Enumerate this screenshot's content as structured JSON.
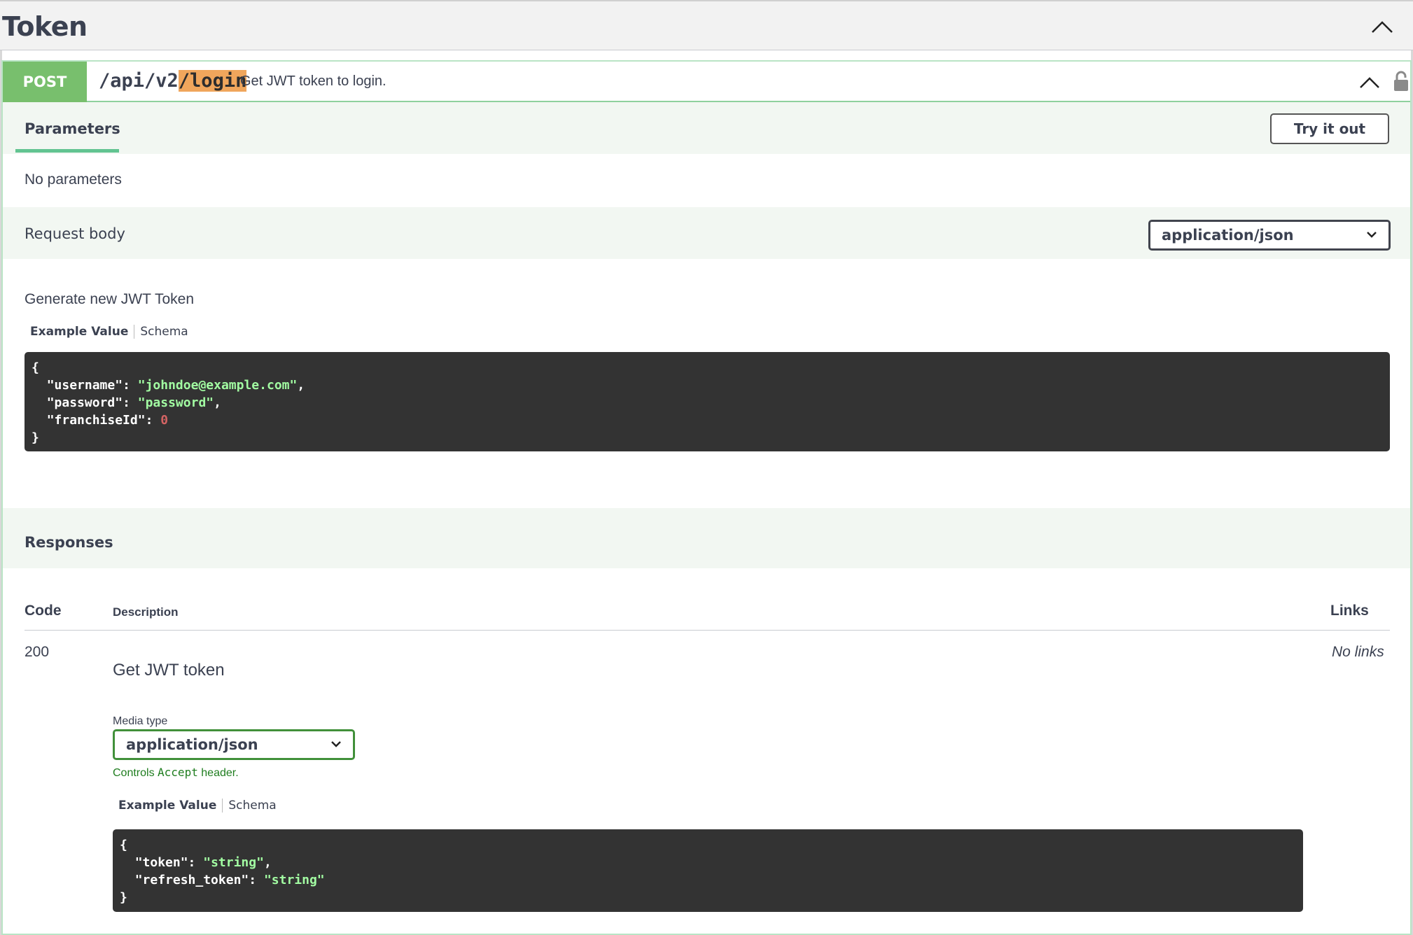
{
  "tag": {
    "title": "Token"
  },
  "operation": {
    "method": "POST",
    "path_prefix": "/api/v2",
    "path_highlight": "/login",
    "summary": "Get JWT token to login."
  },
  "parameters": {
    "tab_label": "Parameters",
    "try_button": "Try it out",
    "empty_text": "No parameters"
  },
  "request_body": {
    "label": "Request body",
    "content_type": "application/json",
    "description": "Generate new JWT Token",
    "example_tab": "Example Value",
    "schema_tab": "Schema",
    "example_json": {
      "open": "{",
      "username_key": "\"username\"",
      "username_val": "\"johndoe@example.com\"",
      "password_key": "\"password\"",
      "password_val": "\"password\"",
      "franchise_key": "\"franchiseId\"",
      "franchise_val": "0",
      "close": "}"
    }
  },
  "responses": {
    "title": "Responses",
    "columns": {
      "code": "Code",
      "description": "Description",
      "links": "Links"
    },
    "rows": [
      {
        "code": "200",
        "description": "Get JWT token",
        "links": "No links",
        "media_type_label": "Media type",
        "media_type": "application/json",
        "controls_prefix": "Controls ",
        "controls_mono": "Accept",
        "controls_suffix": " header.",
        "example_tab": "Example Value",
        "schema_tab": "Schema",
        "example_json": {
          "open": "{",
          "token_key": "\"token\"",
          "token_val": "\"string\"",
          "refresh_key": "\"refresh_token\"",
          "refresh_val": "\"string\"",
          "close": "}"
        }
      }
    ]
  },
  "colors": {
    "method_post": "#78bf6d",
    "path_highlight": "#f0a65c",
    "code_bg": "#333333",
    "code_string": "#a2fca2",
    "code_number": "#d36363",
    "section_bg": "#f2f7f2"
  },
  "icons": {
    "tag_toggle": "chevron-up-icon",
    "op_toggle": "chevron-up-icon",
    "auth": "lock-icon",
    "select_caret": "chevron-down-icon"
  }
}
